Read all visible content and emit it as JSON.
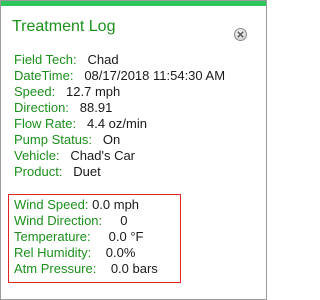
{
  "colors": {
    "accent": "#2cc65a",
    "label": "#1d8f1d",
    "value": "#1a1a1a",
    "highlight_border": "#e02424"
  },
  "popup": {
    "title": "Treatment Log",
    "close_icon": "close-circle-icon"
  },
  "fields": [
    {
      "label": "Field Tech:",
      "value": "Chad"
    },
    {
      "label": "DateTime:",
      "value": "08/17/2018 11:54:30 AM"
    },
    {
      "label": "Speed:",
      "value": "12.7 mph"
    },
    {
      "label": "Direction:",
      "value": "88.91"
    },
    {
      "label": "Flow Rate:",
      "value": "4.4 oz/min"
    },
    {
      "label": "Pump Status:",
      "value": "On"
    },
    {
      "label": "Vehicle:",
      "value": "Chad's Car"
    },
    {
      "label": "Product:",
      "value": "Duet"
    }
  ],
  "weather_fields": [
    {
      "label": "Wind Speed:",
      "value": "0.0 mph"
    },
    {
      "label": "Wind Direction:",
      "value": "0"
    },
    {
      "label": "Temperature:",
      "value": "0.0 °F"
    },
    {
      "label": "Rel Humidity:",
      "value": "0.0%"
    },
    {
      "label": "Atm Pressure:",
      "value": "0.0 bars"
    }
  ]
}
